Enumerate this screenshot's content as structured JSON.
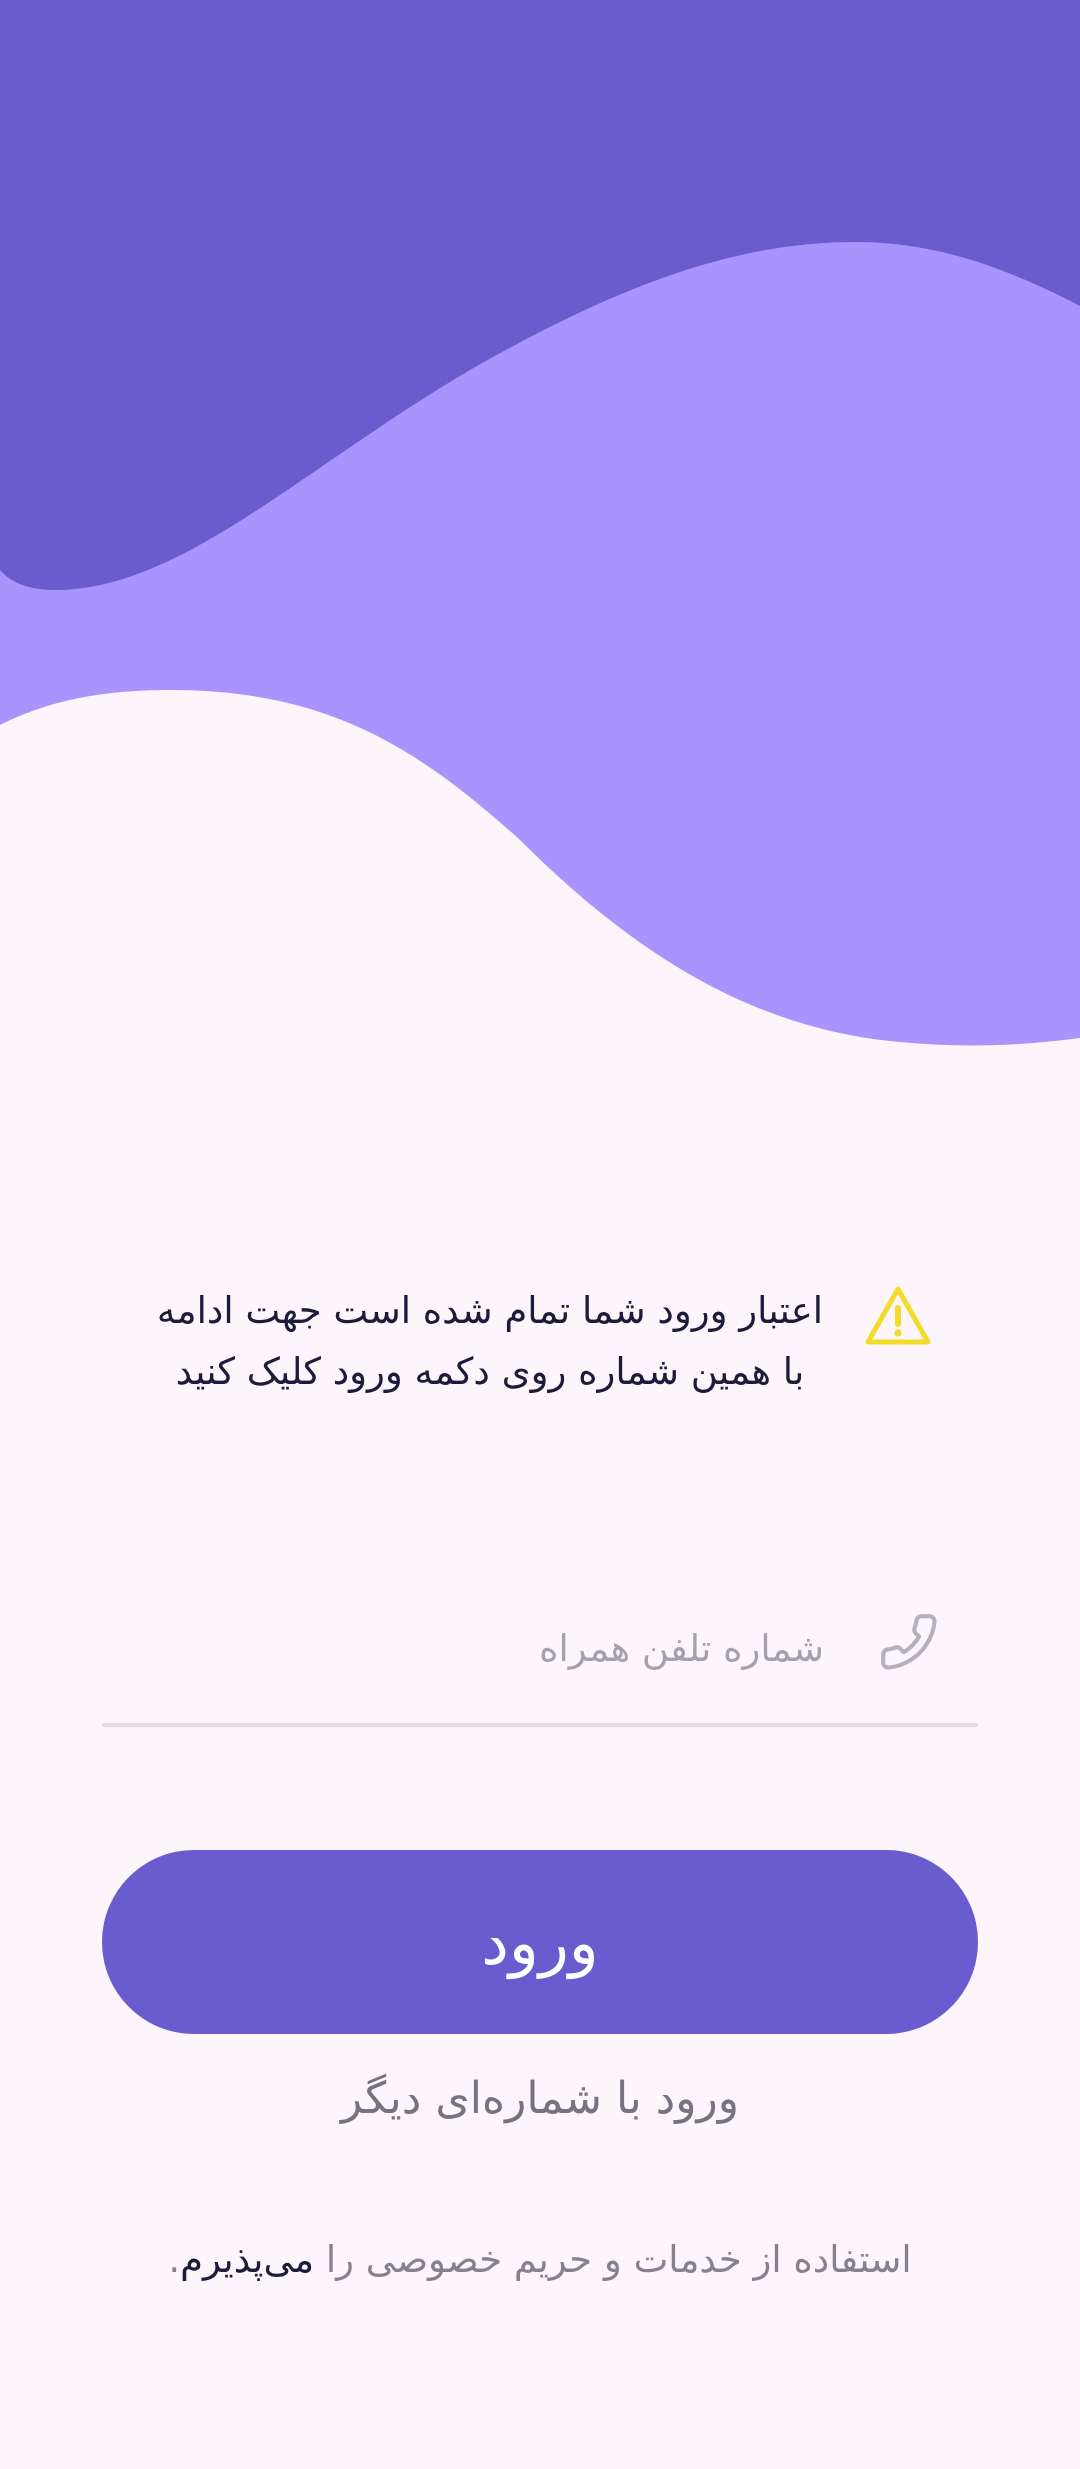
{
  "header": {
    "colors": {
      "background": "#fcf6fc",
      "wave_dark": "#6a5bcf",
      "wave_light": "#a994fd"
    }
  },
  "notice": {
    "icon": "warning-icon",
    "icon_color": "#f2dc29",
    "message": "اعتبار ورود شما تمام شده است جهت ادامه با همین شماره روی دکمه ورود کلیک کنید"
  },
  "phone_field": {
    "icon": "phone-icon",
    "placeholder": "شماره تلفن همراه",
    "value": ""
  },
  "login_button": {
    "label": "ورود",
    "color": "#6a5bcf"
  },
  "alt_login": {
    "label": "ورود با شماره‌ای دیگر"
  },
  "terms": {
    "prefix": "استفاده از خدمات و حریم خصوصی را ",
    "accept": "می‌پذیرم",
    "suffix": "."
  }
}
